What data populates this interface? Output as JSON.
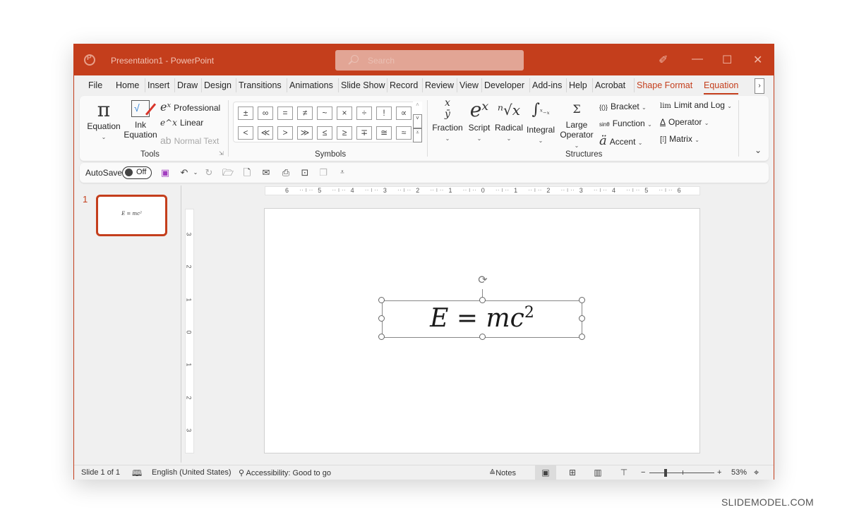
{
  "window": {
    "title": "Presentation1  -  PowerPoint",
    "search_placeholder": "Search",
    "controls": {
      "pen": "✐",
      "minimize": "—",
      "maximize": "☐",
      "close": "✕"
    }
  },
  "tabs": [
    {
      "label": "File"
    },
    {
      "label": "Home"
    },
    {
      "label": "Insert"
    },
    {
      "label": "Draw"
    },
    {
      "label": "Design"
    },
    {
      "label": "Transitions"
    },
    {
      "label": "Animations"
    },
    {
      "label": "Slide Show"
    },
    {
      "label": "Record"
    },
    {
      "label": "Review"
    },
    {
      "label": "View"
    },
    {
      "label": "Developer"
    },
    {
      "label": "Add-ins"
    },
    {
      "label": "Help"
    },
    {
      "label": "Acrobat"
    },
    {
      "label": "Shape Format"
    },
    {
      "label": "Equation"
    }
  ],
  "active_tab": "Equation",
  "ribbon": {
    "tools": {
      "label": "Tools",
      "equation": {
        "glyph": "π",
        "label": "Equation"
      },
      "ink_equation": {
        "line1": "Ink",
        "line2": "Equation"
      },
      "professional": {
        "glyph": "eˣ",
        "label": "Professional"
      },
      "linear": {
        "glyph": "e^x",
        "label": "Linear"
      },
      "normal_text": {
        "glyph": "ab",
        "label": "Normal Text"
      }
    },
    "symbols": {
      "label": "Symbols",
      "row1": [
        "±",
        "∞",
        "=",
        "≠",
        "~",
        "×",
        "÷",
        "!",
        "∝"
      ],
      "row2": [
        "<",
        "≪",
        ">",
        "≫",
        "≤",
        "≥",
        "∓",
        "≅",
        "≈"
      ]
    },
    "structures": {
      "label": "Structures",
      "fraction": {
        "glyph": "x/y",
        "label": "Fraction"
      },
      "script": {
        "glyph": "eˣ",
        "label": "Script"
      },
      "radical": {
        "glyph": "ⁿ√x",
        "label": "Radical"
      },
      "integral": {
        "glyph": "∫",
        "label": "Integral"
      },
      "large_operator": {
        "glyph": "Σ",
        "line1": "Large",
        "line2": "Operator"
      },
      "bracket": {
        "glyph": "{()}",
        "label": "Bracket"
      },
      "function": {
        "glyph": "sinθ",
        "label": "Function"
      },
      "accent": {
        "glyph": "ä",
        "label": "Accent"
      },
      "limit_log": {
        "glyph": "lim",
        "label": "Limit and Log"
      },
      "operator": {
        "glyph": "Δ",
        "label": "Operator"
      },
      "matrix": {
        "glyph": "[⁞]",
        "label": "Matrix"
      }
    }
  },
  "qat": {
    "autosave_label": "AutoSave",
    "autosave_state": "Off"
  },
  "slides_pane": {
    "slide_number": "1",
    "thumb_equation": "E = mc²"
  },
  "rulers": {
    "horizontal": [
      "6",
      "5",
      "4",
      "3",
      "2",
      "1",
      "0",
      "1",
      "2",
      "3",
      "4",
      "5",
      "6"
    ],
    "vertical": [
      "3",
      "2",
      "1",
      "0",
      "1",
      "2",
      "3"
    ]
  },
  "equation": {
    "main": "E = mc",
    "exponent": "2"
  },
  "status": {
    "slide_info": "Slide 1 of 1",
    "language": "English (United States)",
    "accessibility": "Accessibility: Good to go",
    "notes": "Notes",
    "zoom_minus": "−",
    "zoom_plus": "+",
    "zoom_level": "53%"
  },
  "watermark": "SLIDEMODEL.COM"
}
